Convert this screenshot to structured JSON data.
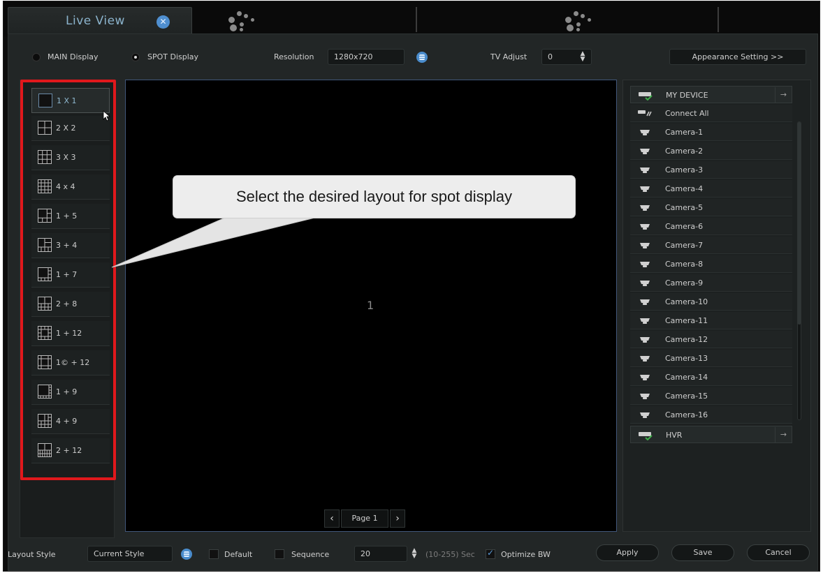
{
  "tabs": {
    "active_label": "Live View"
  },
  "top_bar": {
    "main_display_label": "MAIN Display",
    "spot_display_label": "SPOT Display",
    "selected_display": "SPOT Display",
    "resolution_label": "Resolution",
    "resolution_value": "1280x720",
    "tv_adjust_label": "TV Adjust",
    "tv_adjust_value": "0",
    "appearance_button": "Appearance Setting >>"
  },
  "layouts": [
    {
      "label": "1 X 1",
      "icon": "grid-1x1-icon",
      "selected": true
    },
    {
      "label": "2 X 2",
      "icon": "grid-2x2-icon"
    },
    {
      "label": "3 X 3",
      "icon": "grid-3x3-icon"
    },
    {
      "label": "4 x 4",
      "icon": "grid-4x4-icon"
    },
    {
      "label": "1 + 5",
      "icon": "grid-1plus5-icon"
    },
    {
      "label": "3 + 4",
      "icon": "grid-3plus4-icon"
    },
    {
      "label": "1 + 7",
      "icon": "grid-1plus7-icon"
    },
    {
      "label": "2 + 8",
      "icon": "grid-2plus8-icon"
    },
    {
      "label": "1 + 12",
      "icon": "grid-1plus12-icon"
    },
    {
      "label": "1© + 12",
      "icon": "grid-1cplus12-icon"
    },
    {
      "label": "1 + 9",
      "icon": "grid-1plus9-icon"
    },
    {
      "label": "4 + 9",
      "icon": "grid-4plus9-icon"
    },
    {
      "label": "2 + 12",
      "icon": "grid-2plus12-icon"
    }
  ],
  "video": {
    "channel_number": "1",
    "page_label": "Page 1"
  },
  "callout": {
    "text": "Select the desired layout for spot display"
  },
  "devices": {
    "group_label": "MY DEVICE",
    "connect_all_label": "Connect All",
    "cameras": [
      "Camera-1",
      "Camera-2",
      "Camera-3",
      "Camera-4",
      "Camera-5",
      "Camera-6",
      "Camera-7",
      "Camera-8",
      "Camera-9",
      "Camera-10",
      "Camera-11",
      "Camera-12",
      "Camera-13",
      "Camera-14",
      "Camera-15",
      "Camera-16"
    ],
    "second_group_label": "HVR"
  },
  "bottom_bar": {
    "layout_style_label": "Layout Style",
    "layout_style_value": "Current Style",
    "default_label": "Default",
    "default_checked": false,
    "sequence_label": "Sequence",
    "sequence_checked": false,
    "sequence_value": "20",
    "sequence_range": "(10-255) Sec",
    "optimize_label": "Optimize BW",
    "optimize_checked": true,
    "apply_label": "Apply",
    "save_label": "Save",
    "cancel_label": "Cancel"
  },
  "colors": {
    "accent": "#4a8ccc",
    "highlight": "#e0181c",
    "tab_title": "#8bb3cc"
  }
}
